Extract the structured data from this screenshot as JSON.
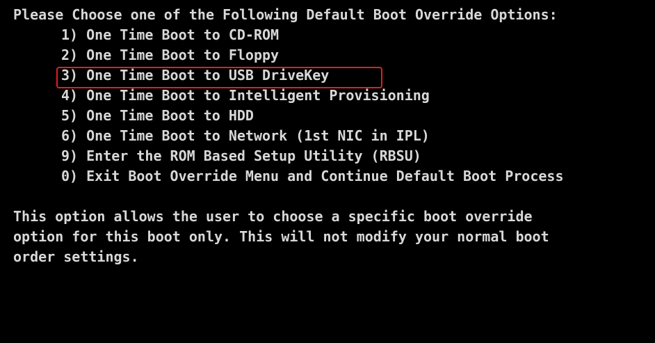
{
  "header": "Please Choose one of the Following Default Boot Override Options:",
  "options": [
    {
      "key": "1)",
      "label": "One Time Boot to CD-ROM"
    },
    {
      "key": "2)",
      "label": "One Time Boot to Floppy"
    },
    {
      "key": "3)",
      "label": "One Time Boot to USB DriveKey"
    },
    {
      "key": "4)",
      "label": "One Time Boot to Intelligent Provisioning"
    },
    {
      "key": "5)",
      "label": "One Time Boot to HDD"
    },
    {
      "key": "6)",
      "label": "One Time Boot to Network (1st NIC in IPL)"
    },
    {
      "key": "9)",
      "label": "Enter the ROM Based Setup Utility (RBSU)"
    },
    {
      "key": "0)",
      "label": "Exit Boot Override Menu and Continue Default Boot Process"
    }
  ],
  "highlighted_option": "3)",
  "description": [
    "This option allows the user to choose a specific boot override",
    "option for this boot only. This will not modify your normal boot",
    "order settings."
  ],
  "colors": {
    "background": "#000000",
    "text": "#d8d8d8",
    "highlight_border": "#e02020"
  }
}
